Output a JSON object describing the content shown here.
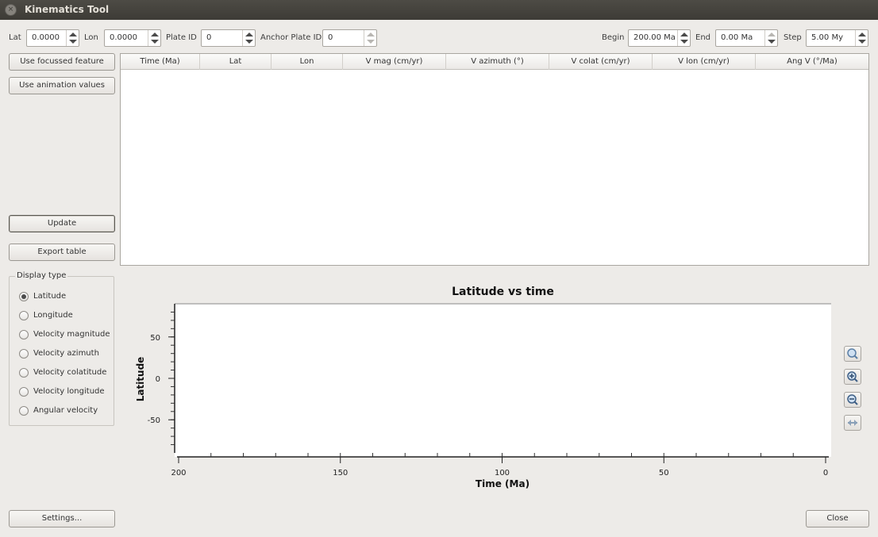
{
  "window": {
    "title": "Kinematics Tool",
    "close_glyph": "×"
  },
  "params": {
    "lat_label": "Lat",
    "lat_value": "0.0000",
    "lon_label": "Lon",
    "lon_value": "0.0000",
    "plate_id_label": "Plate ID",
    "plate_id_value": "0",
    "anchor_label": "Anchor Plate ID",
    "anchor_value": "0",
    "begin_label": "Begin",
    "begin_value": "200.00 Ma",
    "end_label": "End",
    "end_value": "0.00 Ma",
    "step_label": "Step",
    "step_value": "5.00 My"
  },
  "buttons": {
    "use_focussed": "Use focussed feature",
    "use_animation": "Use animation values",
    "update": "Update",
    "export": "Export table",
    "settings": "Settings...",
    "close": "Close"
  },
  "table": {
    "columns": [
      "Time (Ma)",
      "Lat",
      "Lon",
      "V mag (cm/yr)",
      "V azimuth (°)",
      "V colat (cm/yr)",
      "V lon (cm/yr)",
      "Ang V (°/Ma)"
    ],
    "rows": []
  },
  "display_type": {
    "title": "Display type",
    "selected": "Latitude",
    "options": [
      "Latitude",
      "Longitude",
      "Velocity magnitude",
      "Velocity azimuth",
      "Velocity colatitude",
      "Velocity longitude",
      "Angular velocity"
    ]
  },
  "zoom_tools": [
    "magnifier-icon",
    "zoom-in-icon",
    "zoom-out-icon",
    "fit-horizontal-icon"
  ],
  "chart_data": {
    "type": "line",
    "title": "Latitude vs time",
    "xlabel": "Time (Ma)",
    "ylabel": "Latitude",
    "xlim": [
      200,
      0
    ],
    "ylim": [
      -90,
      90
    ],
    "x_ticks": [
      200,
      150,
      100,
      50,
      0
    ],
    "y_ticks": [
      50,
      0,
      -50
    ],
    "grid": false,
    "series": []
  }
}
